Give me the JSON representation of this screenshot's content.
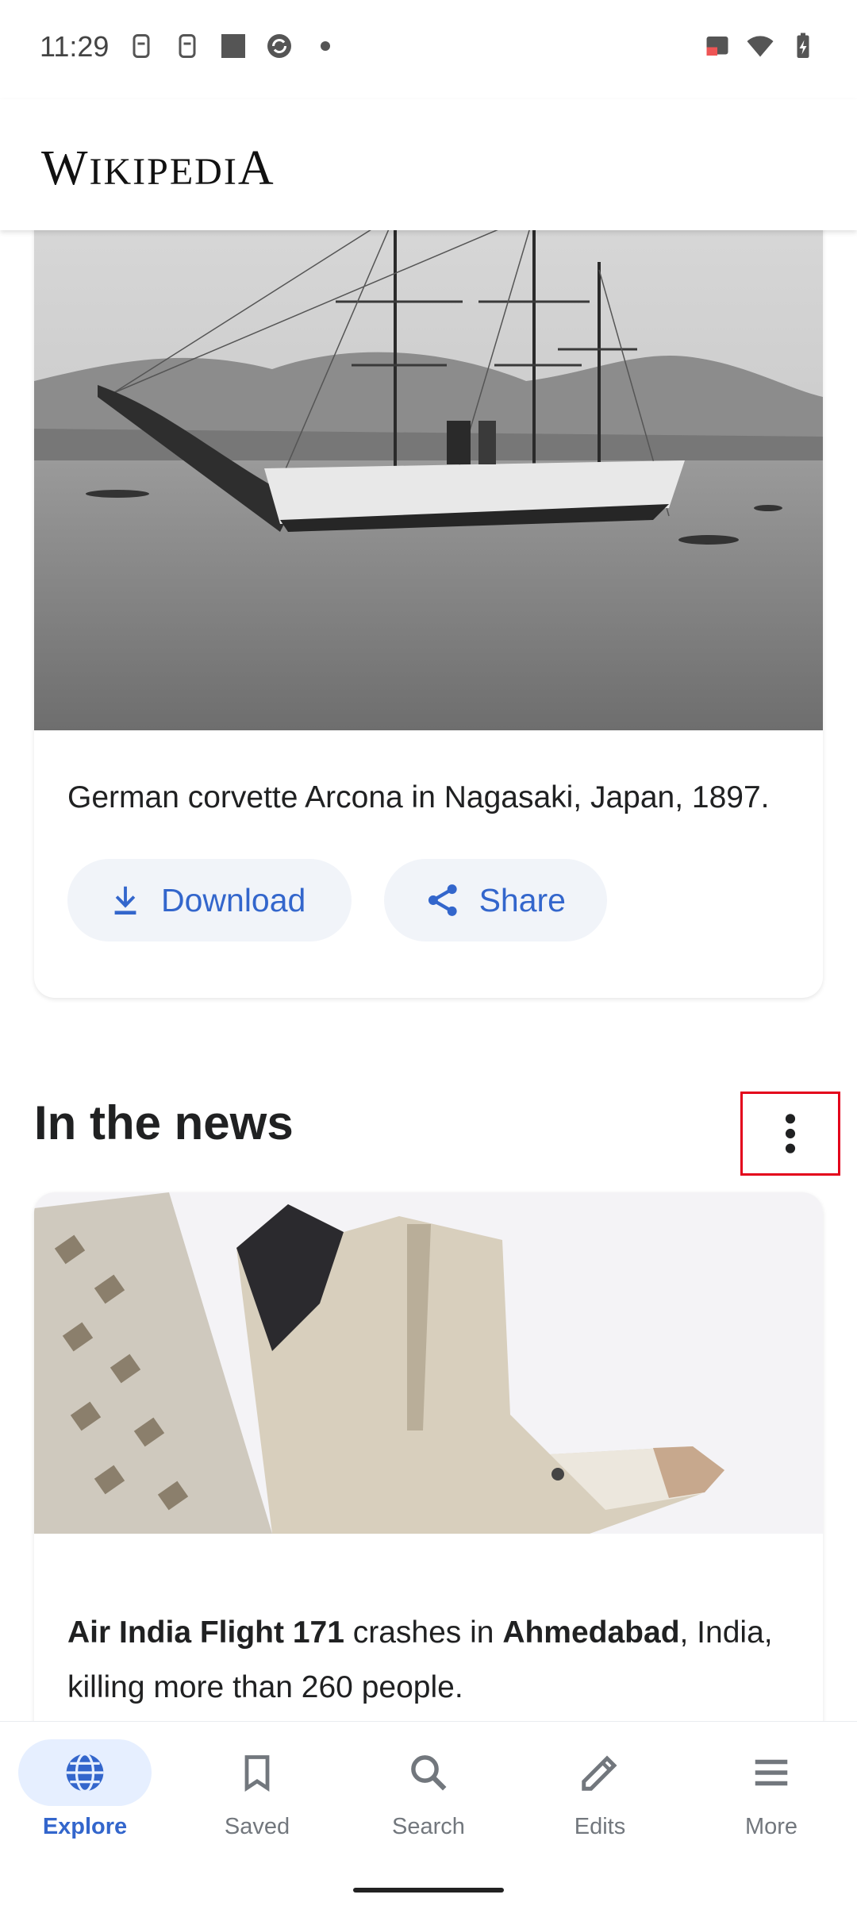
{
  "status_bar": {
    "time": "11:29",
    "left_icons": [
      "sim-icon",
      "sim-icon",
      "app-square-icon",
      "sync-app-icon",
      "dot-icon"
    ],
    "right_icons": [
      "cast-icon",
      "wifi-icon",
      "battery-charging-icon"
    ]
  },
  "header": {
    "wordmark_initial": "W",
    "wordmark_rest": "IKIPEDI",
    "wordmark_end": "A"
  },
  "picture_of_day": {
    "caption": "German corvette Arcona in Nagasaki, Japan, 1897.",
    "download_label": "Download",
    "share_label": "Share"
  },
  "news": {
    "section_title": "In the news",
    "headline_bold1": "Air India Flight 171",
    "headline_mid": " crashes in ",
    "headline_bold2": "Ahmedabad",
    "headline_end": ", India, killing more than 260 people."
  },
  "bottom_nav": {
    "items": [
      {
        "label": "Explore",
        "icon": "globe-icon",
        "active": true
      },
      {
        "label": "Saved",
        "icon": "bookmark-icon",
        "active": false
      },
      {
        "label": "Search",
        "icon": "search-icon",
        "active": false
      },
      {
        "label": "Edits",
        "icon": "pencil-icon",
        "active": false
      },
      {
        "label": "More",
        "icon": "menu-icon",
        "active": false
      }
    ]
  },
  "colors": {
    "accent": "#3366cc",
    "highlight_border": "#e3001b",
    "button_bg": "#f1f4f9"
  }
}
